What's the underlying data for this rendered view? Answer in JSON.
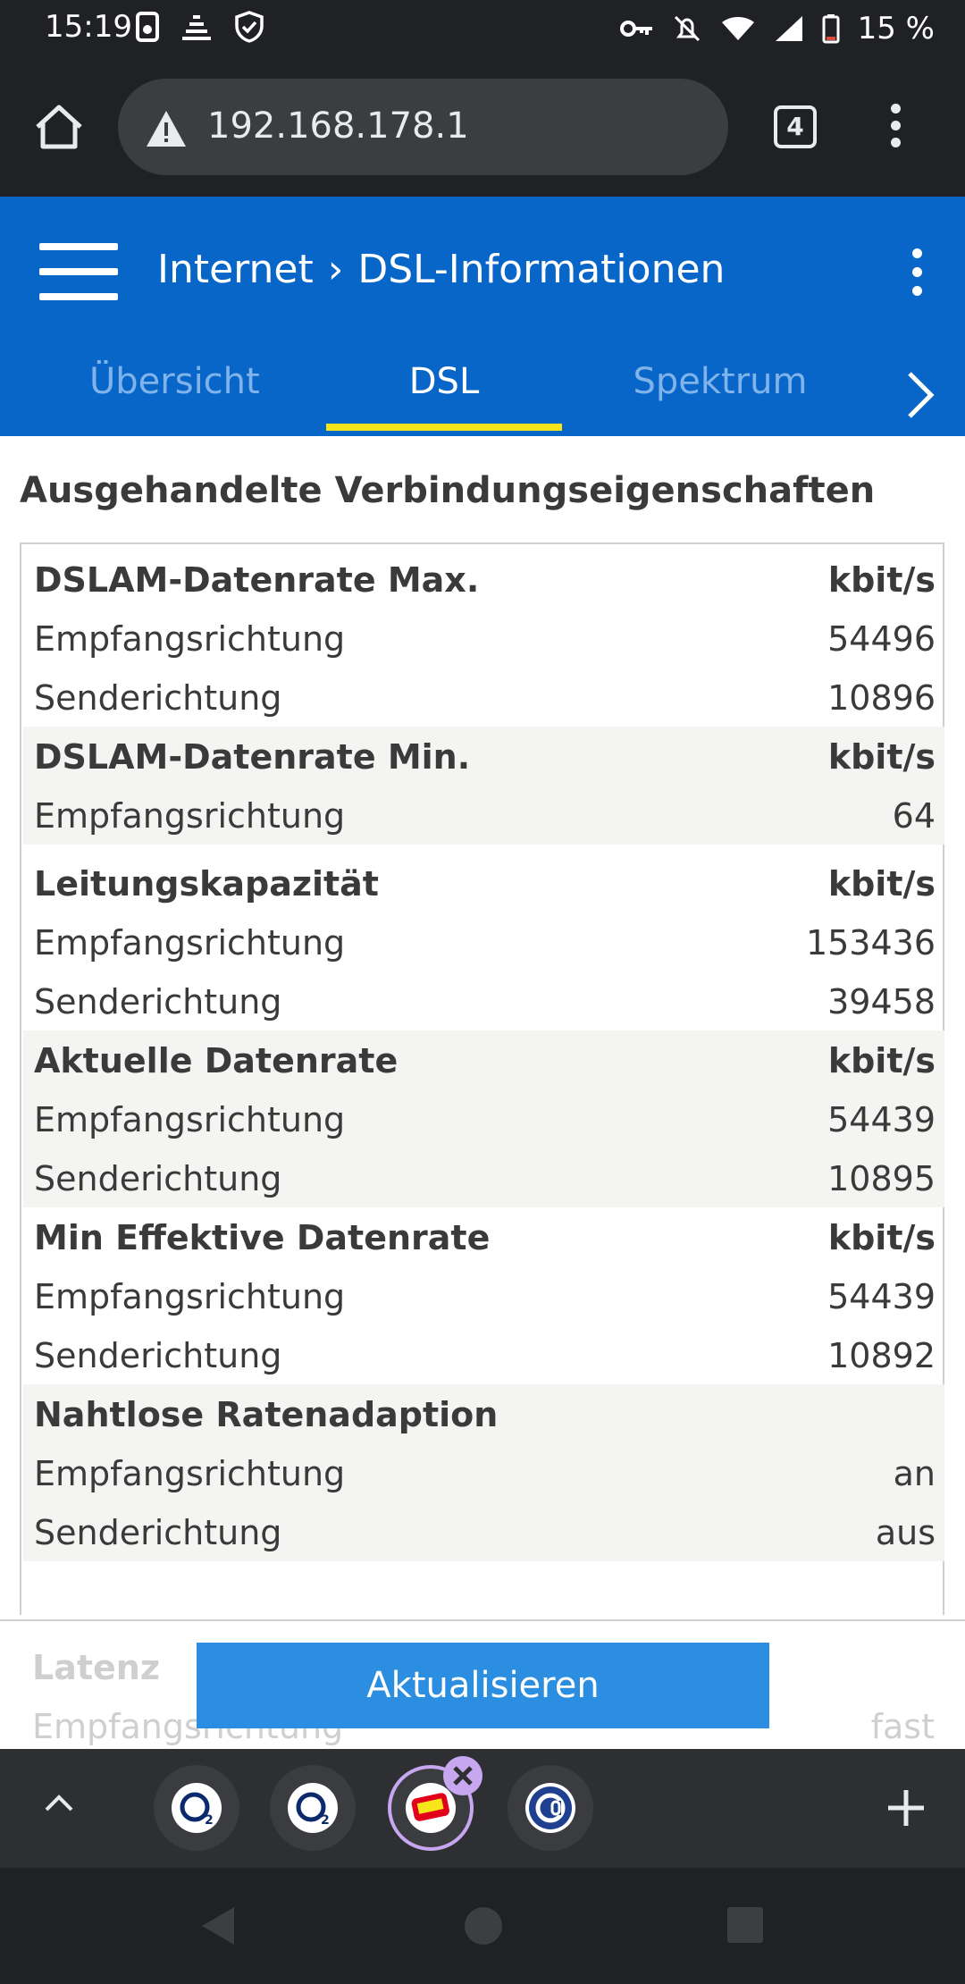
{
  "status_bar": {
    "time": "15:19",
    "battery_text": "15 %",
    "icons_left": [
      "sim-icon",
      "vpn-keyring-icon",
      "shield-icon"
    ],
    "icons_right": [
      "key-icon",
      "mute-icon",
      "wifi-icon",
      "signal-icon",
      "battery-icon"
    ]
  },
  "browser": {
    "url": "192.168.178.1",
    "tab_count": "4"
  },
  "header": {
    "crumb_parent": "Internet",
    "crumb_current": "DSL-Informationen",
    "tabs": [
      {
        "label": "Übersicht",
        "active": false
      },
      {
        "label": "DSL",
        "active": true
      },
      {
        "label": "Spektrum",
        "active": false
      }
    ],
    "accent": "#0866c8",
    "tab_indicator_color": "#f6e51b"
  },
  "content": {
    "section_title": "Ausgehandelte Verbindungseigenschaften",
    "rows": [
      {
        "label": "DSLAM-Datenrate Max.",
        "value": "kbit/s",
        "bold": true
      },
      {
        "label": "Empfangsrichtung",
        "value": "54496"
      },
      {
        "label": "Senderichtung",
        "value": "10896"
      },
      {
        "label": "DSLAM-Datenrate Min.",
        "value": "kbit/s",
        "bold": true
      },
      {
        "label": "Empfangsrichtung",
        "value": "64"
      },
      {
        "label": "Leitungskapazität",
        "value": "kbit/s",
        "bold": true
      },
      {
        "label": "Empfangsrichtung",
        "value": "153436"
      },
      {
        "label": "Senderichtung",
        "value": "39458"
      },
      {
        "label": "Aktuelle Datenrate",
        "value": "kbit/s",
        "bold": true
      },
      {
        "label": "Empfangsrichtung",
        "value": "54439"
      },
      {
        "label": "Senderichtung",
        "value": "10895"
      },
      {
        "label": "Min Effektive Datenrate",
        "value": "kbit/s",
        "bold": true
      },
      {
        "label": "Empfangsrichtung",
        "value": "54439"
      },
      {
        "label": "Senderichtung",
        "value": "10892"
      },
      {
        "label": "Nahtlose Ratenadaption",
        "value": "",
        "bold": true
      },
      {
        "label": "Empfangsrichtung",
        "value": "an"
      },
      {
        "label": "Senderichtung",
        "value": "aus"
      }
    ],
    "faded_rows": [
      {
        "label": "Latenz",
        "value": ""
      },
      {
        "label": "Empfangsrichtung",
        "value": "fast"
      }
    ],
    "update_button": "Aktualisieren"
  },
  "tab_strip": {
    "tabs": [
      "o2-tab-icon",
      "o2-tab-icon",
      "fritz-tab-icon",
      "computerbase-tab-icon"
    ],
    "active_index": 2
  }
}
